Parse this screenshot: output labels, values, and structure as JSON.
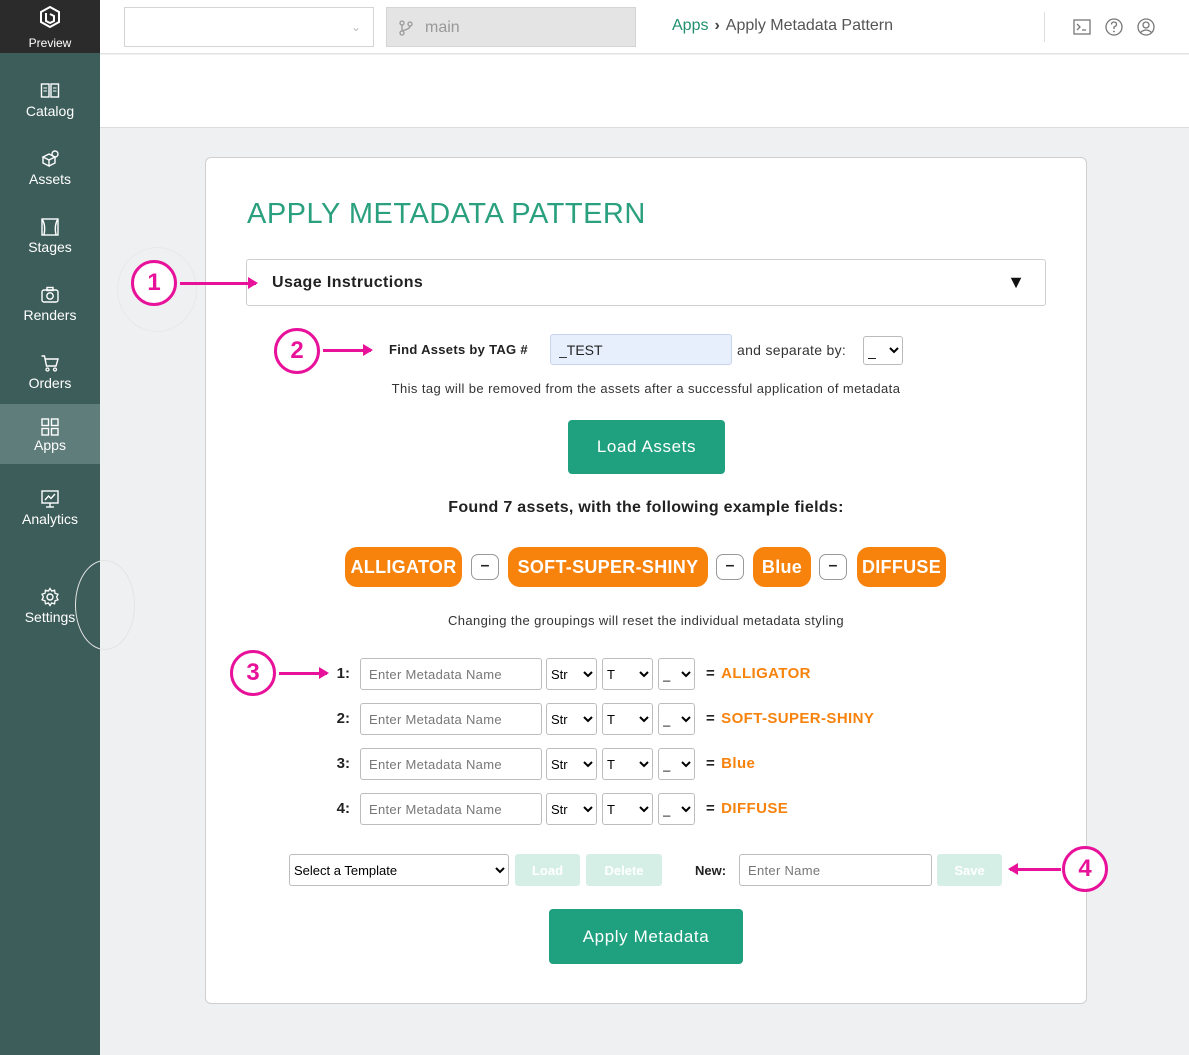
{
  "sidebar": {
    "logo_label": "Preview",
    "items": [
      {
        "label": "Catalog",
        "icon": "catalog-icon"
      },
      {
        "label": "Assets",
        "icon": "assets-icon"
      },
      {
        "label": "Stages",
        "icon": "stages-icon"
      },
      {
        "label": "Renders",
        "icon": "camera-icon"
      },
      {
        "label": "Orders",
        "icon": "cart-icon"
      },
      {
        "label": "Apps",
        "icon": "apps-grid-icon",
        "active": true
      },
      {
        "label": "Analytics",
        "icon": "analytics-icon"
      },
      {
        "label": "Settings",
        "icon": "gear-icon"
      }
    ]
  },
  "topbar": {
    "branch": "main",
    "breadcrumb": {
      "link": "Apps",
      "separator": "›",
      "current": "Apply Metadata Pattern"
    }
  },
  "page": {
    "title": "APPLY METADATA PATTERN",
    "usage_instructions": "Usage Instructions",
    "find_label": "Find Assets by TAG #",
    "tag_value": "_TEST",
    "separate_label": "and separate by:",
    "separator_value": "_",
    "tag_hint": "This tag will be removed from the assets after a successful application of metadata",
    "load_assets_label": "Load Assets",
    "found_text": "Found 7 assets, with the following example fields:",
    "fields": [
      "ALLIGATOR",
      "SOFT-SUPER-SHINY",
      "Blue",
      "DIFFUSE"
    ],
    "field_separator": "–",
    "grouping_hint": "Changing the groupings will reset the individual metadata styling",
    "rows": [
      {
        "num": "1:",
        "type": "Str",
        "case": "T",
        "sep": "_",
        "value": "ALLIGATOR"
      },
      {
        "num": "2:",
        "type": "Str",
        "case": "T",
        "sep": "_",
        "value": "SOFT-SUPER-SHINY"
      },
      {
        "num": "3:",
        "type": "Str",
        "case": "T",
        "sep": "_",
        "value": "Blue"
      },
      {
        "num": "4:",
        "type": "Str",
        "case": "T",
        "sep": "_",
        "value": "DIFFUSE"
      }
    ],
    "metadata_placeholder": "Enter Metadata Name",
    "equals": "=",
    "template_select": "Select a Template",
    "load_label": "Load",
    "delete_label": "Delete",
    "new_label": "New:",
    "name_placeholder": "Enter Name",
    "save_label": "Save",
    "apply_label": "Apply Metadata"
  },
  "annotations": [
    "1",
    "2",
    "3",
    "4"
  ],
  "colors": {
    "sidebar": "#3d5d5a",
    "accent_green": "#1fa07f",
    "title_green": "#2aa07e",
    "chip_orange": "#f7820c",
    "annotation_pink": "#e8129a"
  }
}
